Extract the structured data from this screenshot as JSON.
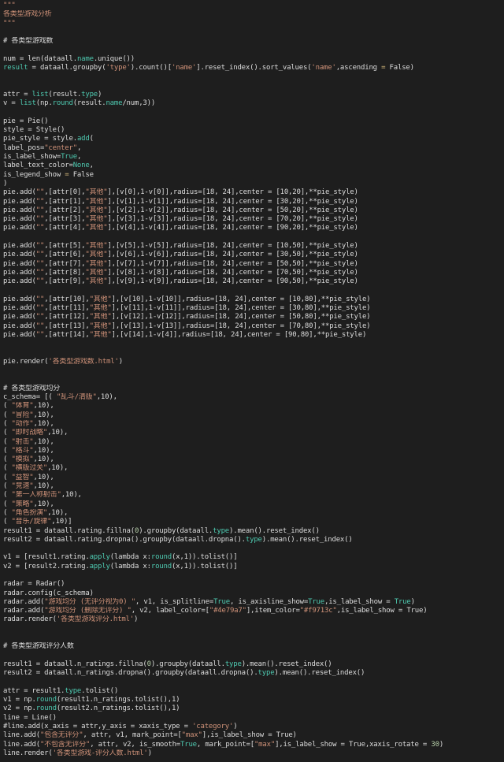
{
  "colors": {
    "background": "#1e1e1e",
    "default": "#dcdcdc",
    "string": "#ce9178",
    "comment": "#dcdcdc",
    "keyword": "#4ec9b0",
    "number": "#b5cea8",
    "op": "#d7ba7d"
  },
  "editor": {
    "lines": [
      [
        [
          "string",
          "\"\"\""
        ]
      ],
      [
        [
          "string",
          "各类型游戏分析"
        ]
      ],
      [
        [
          "string",
          "\"\"\""
        ]
      ],
      [],
      [
        [
          "comment",
          "# 各类型游戏数"
        ]
      ],
      [],
      [
        [
          "default",
          "num = len(dataall."
        ],
        [
          "keyword",
          "name"
        ],
        [
          "default",
          ".unique())"
        ]
      ],
      [
        [
          "keyword",
          "result"
        ],
        [
          "default",
          " = dataall.groupby("
        ],
        [
          "string",
          "'type'"
        ],
        [
          "default",
          ").count()["
        ],
        [
          "string",
          "'name'"
        ],
        [
          "default",
          "].reset_index().sort_values("
        ],
        [
          "string",
          "'name'"
        ],
        [
          "default",
          ",ascending "
        ],
        [
          "op",
          "="
        ],
        [
          "default",
          " False)"
        ]
      ],
      [],
      [],
      [
        [
          "default",
          "attr = "
        ],
        [
          "keyword",
          "list"
        ],
        [
          "default",
          "(result."
        ],
        [
          "keyword",
          "type"
        ],
        [
          "default",
          ")"
        ]
      ],
      [
        [
          "default",
          "v = "
        ],
        [
          "keyword",
          "list"
        ],
        [
          "default",
          "(np."
        ],
        [
          "keyword",
          "round"
        ],
        [
          "default",
          "(result."
        ],
        [
          "keyword",
          "name"
        ],
        [
          "default",
          "/num,3))"
        ]
      ],
      [],
      [
        [
          "default",
          "pie = Pie()"
        ]
      ],
      [
        [
          "default",
          "style = Style()"
        ]
      ],
      [
        [
          "default",
          "pie_style = style."
        ],
        [
          "keyword",
          "add"
        ],
        [
          "default",
          "("
        ]
      ],
      [
        [
          "default",
          "label_pos="
        ],
        [
          "string",
          "\"center\""
        ],
        [
          "default",
          ","
        ]
      ],
      [
        [
          "default",
          "is_label_show="
        ],
        [
          "keyword",
          "True"
        ],
        [
          "default",
          ","
        ]
      ],
      [
        [
          "default",
          "label_text_color="
        ],
        [
          "keyword",
          "None"
        ],
        [
          "default",
          ","
        ]
      ],
      [
        [
          "default",
          "is_legend_show "
        ],
        [
          "op",
          "="
        ],
        [
          "default",
          " False"
        ]
      ],
      [
        [
          "default",
          ")"
        ]
      ],
      [
        [
          "default",
          "pie.add("
        ],
        [
          "string",
          "\"\""
        ],
        [
          "default",
          ",[attr[0],"
        ],
        [
          "string",
          "\"其他\""
        ],
        [
          "default",
          "],[v[0],1-v[0]],radius=[18, 24],center = [10,20],**pie_style)"
        ]
      ],
      [
        [
          "default",
          "pie.add("
        ],
        [
          "string",
          "\"\""
        ],
        [
          "default",
          ",[attr[1],"
        ],
        [
          "string",
          "\"其他\""
        ],
        [
          "default",
          "],[v[1],1-v[1]],radius=[18, 24],center = [30,20],**pie_style)"
        ]
      ],
      [
        [
          "default",
          "pie.add("
        ],
        [
          "string",
          "\"\""
        ],
        [
          "default",
          ",[attr[2],"
        ],
        [
          "string",
          "\"其他\""
        ],
        [
          "default",
          "],[v[2],1-v[2]],radius=[18, 24],center = [50,20],**pie_style)"
        ]
      ],
      [
        [
          "default",
          "pie.add("
        ],
        [
          "string",
          "\"\""
        ],
        [
          "default",
          ",[attr[3],"
        ],
        [
          "string",
          "\"其他\""
        ],
        [
          "default",
          "],[v[3],1-v[3]],radius=[18, 24],center = [70,20],**pie_style)"
        ]
      ],
      [
        [
          "default",
          "pie.add("
        ],
        [
          "string",
          "\"\""
        ],
        [
          "default",
          ",[attr[4],"
        ],
        [
          "string",
          "\"其他\""
        ],
        [
          "default",
          "],[v[4],1-v[4]],radius=[18, 24],center = [90,20],**pie_style)"
        ]
      ],
      [],
      [
        [
          "default",
          "pie.add("
        ],
        [
          "string",
          "\"\""
        ],
        [
          "default",
          ",[attr[5],"
        ],
        [
          "string",
          "\"其他\""
        ],
        [
          "default",
          "],[v[5],1-v[5]],radius=[18, 24],center = [10,50],**pie_style)"
        ]
      ],
      [
        [
          "default",
          "pie.add("
        ],
        [
          "string",
          "\"\""
        ],
        [
          "default",
          ",[attr[6],"
        ],
        [
          "string",
          "\"其他\""
        ],
        [
          "default",
          "],[v[6],1-v[6]],radius=[18, 24],center = [30,50],**pie_style)"
        ]
      ],
      [
        [
          "default",
          "pie.add("
        ],
        [
          "string",
          "\"\""
        ],
        [
          "default",
          ",[attr[7],"
        ],
        [
          "string",
          "\"其他\""
        ],
        [
          "default",
          "],[v[7],1-v[7]],radius=[18, 24],center = [50,50],**pie_style)"
        ]
      ],
      [
        [
          "default",
          "pie.add("
        ],
        [
          "string",
          "\"\""
        ],
        [
          "default",
          ",[attr[8],"
        ],
        [
          "string",
          "\"其他\""
        ],
        [
          "default",
          "],[v[8],1-v[8]],radius=[18, 24],center = [70,50],**pie_style)"
        ]
      ],
      [
        [
          "default",
          "pie.add("
        ],
        [
          "string",
          "\"\""
        ],
        [
          "default",
          ",[attr[9],"
        ],
        [
          "string",
          "\"其他\""
        ],
        [
          "default",
          "],[v[9],1-v[9]],radius=[18, 24],center = [90,50],**pie_style)"
        ]
      ],
      [],
      [
        [
          "default",
          "pie.add("
        ],
        [
          "string",
          "\"\""
        ],
        [
          "default",
          ",[attr[10],"
        ],
        [
          "string",
          "\"其他\""
        ],
        [
          "default",
          "],[v[10],1-v[10]],radius=[18, 24],center = [10,80],**pie_style)"
        ]
      ],
      [
        [
          "default",
          "pie.add("
        ],
        [
          "string",
          "\"\""
        ],
        [
          "default",
          ",[attr[11],"
        ],
        [
          "string",
          "\"其他\""
        ],
        [
          "default",
          "],[v[11],1-v[11]],radius=[18, 24],center = [30,80],**pie_style)"
        ]
      ],
      [
        [
          "default",
          "pie.add("
        ],
        [
          "string",
          "\"\""
        ],
        [
          "default",
          ",[attr[12],"
        ],
        [
          "string",
          "\"其他\""
        ],
        [
          "default",
          "],[v[12],1-v[12]],radius=[18, 24],center = [50,80],**pie_style)"
        ]
      ],
      [
        [
          "default",
          "pie.add("
        ],
        [
          "string",
          "\"\""
        ],
        [
          "default",
          ",[attr[13],"
        ],
        [
          "string",
          "\"其他\""
        ],
        [
          "default",
          "],[v[13],1-v[13]],radius=[18, 24],center = [70,80],**pie_style)"
        ]
      ],
      [
        [
          "default",
          "pie.add("
        ],
        [
          "string",
          "\"\""
        ],
        [
          "default",
          ",[attr[14],"
        ],
        [
          "string",
          "\"其他\""
        ],
        [
          "default",
          "],[v[14],1-v[4]],radius=[18, 24],center = [90,80],**pie_style)"
        ]
      ],
      [],
      [],
      [
        [
          "default",
          "pie.render("
        ],
        [
          "string",
          "'各类型游戏数.html'"
        ],
        [
          "default",
          ")"
        ]
      ],
      [],
      [],
      [
        [
          "comment",
          "# 各类型游戏均分"
        ]
      ],
      [
        [
          "default",
          "c_schema= [( "
        ],
        [
          "string",
          "\"乱斗/清版\""
        ],
        [
          "default",
          ",10),"
        ]
      ],
      [
        [
          "default",
          "( "
        ],
        [
          "string",
          "\"体育\""
        ],
        [
          "default",
          ",10),"
        ]
      ],
      [
        [
          "default",
          "( "
        ],
        [
          "string",
          "\"冒险\""
        ],
        [
          "default",
          ",10),"
        ]
      ],
      [
        [
          "default",
          "( "
        ],
        [
          "string",
          "\"动作\""
        ],
        [
          "default",
          ",10),"
        ]
      ],
      [
        [
          "default",
          "( "
        ],
        [
          "string",
          "\"即时战略\""
        ],
        [
          "default",
          ",10),"
        ]
      ],
      [
        [
          "default",
          "( "
        ],
        [
          "string",
          "\"射击\""
        ],
        [
          "default",
          ",10),"
        ]
      ],
      [
        [
          "default",
          "( "
        ],
        [
          "string",
          "\"格斗\""
        ],
        [
          "default",
          ",10),"
        ]
      ],
      [
        [
          "default",
          "( "
        ],
        [
          "string",
          "\"模拟\""
        ],
        [
          "default",
          ",10),"
        ]
      ],
      [
        [
          "default",
          "( "
        ],
        [
          "string",
          "\"横版过关\""
        ],
        [
          "default",
          ",10),"
        ]
      ],
      [
        [
          "default",
          "( "
        ],
        [
          "string",
          "\"益智\""
        ],
        [
          "default",
          ",10),"
        ]
      ],
      [
        [
          "default",
          "( "
        ],
        [
          "string",
          "\"竞速\""
        ],
        [
          "default",
          ",10),"
        ]
      ],
      [
        [
          "default",
          "( "
        ],
        [
          "string",
          "\"第一人称射击\""
        ],
        [
          "default",
          ",10),"
        ]
      ],
      [
        [
          "default",
          "( "
        ],
        [
          "string",
          "\"策略\""
        ],
        [
          "default",
          ",10),"
        ]
      ],
      [
        [
          "default",
          "( "
        ],
        [
          "string",
          "\"角色扮演\""
        ],
        [
          "default",
          ",10),"
        ]
      ],
      [
        [
          "default",
          "( "
        ],
        [
          "string",
          "\"音乐/旋律\""
        ],
        [
          "default",
          ",10)]"
        ]
      ],
      [
        [
          "default",
          "result1 = dataall.rating.fillna("
        ],
        [
          "number",
          "0"
        ],
        [
          "default",
          ").groupby(dataall."
        ],
        [
          "keyword",
          "type"
        ],
        [
          "default",
          ").mean().reset_index()"
        ]
      ],
      [
        [
          "default",
          "result2 = dataall.rating.dropna().groupby(dataall.dropna()."
        ],
        [
          "keyword",
          "type"
        ],
        [
          "default",
          ").mean().reset_index()"
        ]
      ],
      [],
      [
        [
          "default",
          "v1 = [result1.rating."
        ],
        [
          "keyword",
          "apply"
        ],
        [
          "default",
          "(lambda x:"
        ],
        [
          "keyword",
          "round"
        ],
        [
          "default",
          "(x,1)).tolist()]"
        ]
      ],
      [
        [
          "default",
          "v2 = [result2.rating."
        ],
        [
          "keyword",
          "apply"
        ],
        [
          "default",
          "(lambda x:"
        ],
        [
          "keyword",
          "round"
        ],
        [
          "default",
          "(x,1)).tolist()]"
        ]
      ],
      [],
      [
        [
          "default",
          "radar = Radar()"
        ]
      ],
      [
        [
          "default",
          "radar.config(c_schema)"
        ]
      ],
      [
        [
          "default",
          "radar.add("
        ],
        [
          "string",
          "\"游戏均分 (无评分视为0) \""
        ],
        [
          "default",
          ", v1, is_splitline="
        ],
        [
          "keyword",
          "True"
        ],
        [
          "default",
          ", is_axisline_show="
        ],
        [
          "keyword",
          "True"
        ],
        [
          "default",
          ",is_label_show = "
        ],
        [
          "keyword",
          "True"
        ],
        [
          "default",
          ")"
        ]
      ],
      [
        [
          "default",
          "radar.add("
        ],
        [
          "string",
          "\"游戏均分 (删除无评分) \""
        ],
        [
          "default",
          ", v2, label_color=["
        ],
        [
          "string",
          "\"#4e79a7\""
        ],
        [
          "default",
          "],item_color="
        ],
        [
          "string",
          "\"#f9713c\""
        ],
        [
          "default",
          ",is_label_show = True)"
        ]
      ],
      [
        [
          "default",
          "radar.render("
        ],
        [
          "string",
          "'各类型游戏评分.html'"
        ],
        [
          "default",
          ")"
        ]
      ],
      [],
      [],
      [
        [
          "comment",
          "# 各类型游戏评分人数"
        ]
      ],
      [],
      [
        [
          "default",
          "result1 = dataall.n_ratings.fillna("
        ],
        [
          "number",
          "0"
        ],
        [
          "default",
          ").groupby(dataall."
        ],
        [
          "keyword",
          "type"
        ],
        [
          "default",
          ").mean().reset_index()"
        ]
      ],
      [
        [
          "default",
          "result2 = dataall.n_ratings.dropna().groupby(dataall.dropna()."
        ],
        [
          "keyword",
          "type"
        ],
        [
          "default",
          ").mean().reset_index()"
        ]
      ],
      [],
      [
        [
          "default",
          "attr = result1."
        ],
        [
          "keyword",
          "type"
        ],
        [
          "default",
          ".tolist()"
        ]
      ],
      [
        [
          "default",
          "v1 = np."
        ],
        [
          "keyword",
          "round"
        ],
        [
          "default",
          "(result1.n_ratings.tolist(),1)"
        ]
      ],
      [
        [
          "default",
          "v2 = np."
        ],
        [
          "keyword",
          "round"
        ],
        [
          "default",
          "(result2.n_ratings.tolist(),1)"
        ]
      ],
      [
        [
          "default",
          "line = Line()"
        ]
      ],
      [
        [
          "default",
          "#line.add(x_axis = attr,y_axis = xaxis_type = "
        ],
        [
          "string",
          "'category'"
        ],
        [
          "default",
          ")"
        ]
      ],
      [
        [
          "default",
          "line.add("
        ],
        [
          "string",
          "\"包含无评分\""
        ],
        [
          "default",
          ", attr, v1, mark_point=["
        ],
        [
          "string",
          "\"max\""
        ],
        [
          "default",
          "],is_label_show = True)"
        ]
      ],
      [
        [
          "default",
          "line.add("
        ],
        [
          "string",
          "\"不包含无评分\""
        ],
        [
          "default",
          ", attr, v2, is_smooth="
        ],
        [
          "keyword",
          "True"
        ],
        [
          "default",
          ", mark_point=["
        ],
        [
          "string",
          "\"max\""
        ],
        [
          "default",
          "],is_label_show = True,xaxis_rotate = "
        ],
        [
          "number",
          "30"
        ],
        [
          "default",
          ")"
        ]
      ],
      [
        [
          "default",
          "line.render("
        ],
        [
          "string",
          "'各类型游戏-评分人数.html'"
        ],
        [
          "default",
          ")"
        ]
      ]
    ]
  }
}
